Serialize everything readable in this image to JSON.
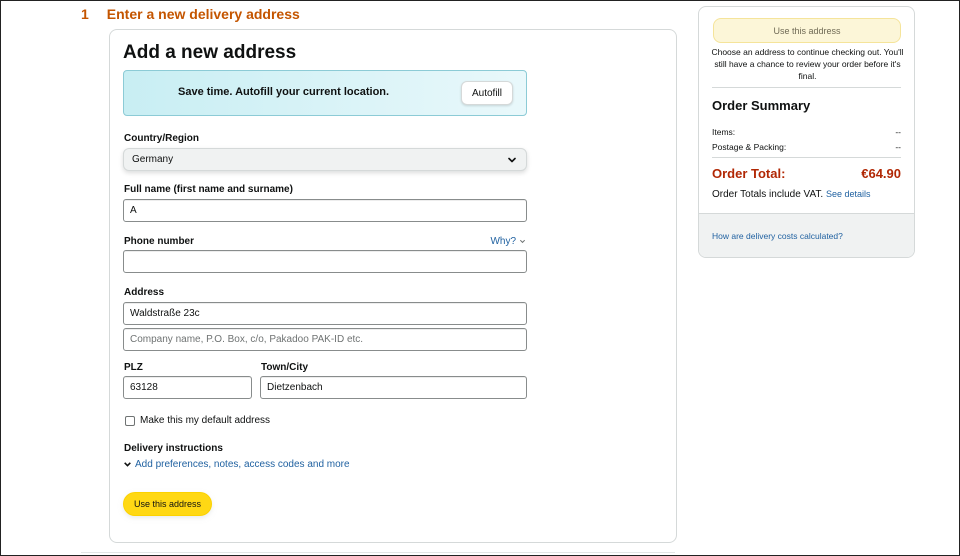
{
  "step": {
    "number": "1",
    "title": "Enter a new delivery address"
  },
  "form": {
    "title": "Add a new address",
    "autofill": {
      "text": "Save time. Autofill your current location.",
      "button": "Autofill"
    },
    "country": {
      "label": "Country/Region",
      "value": "Germany"
    },
    "full_name": {
      "label": "Full name (first name and surname)",
      "value": "A"
    },
    "phone": {
      "label": "Phone number",
      "value": "",
      "why_link": "Why?"
    },
    "address": {
      "label": "Address",
      "line1_value": "Waldstraße 23c",
      "line2_placeholder": "Company name, P.O. Box, c/o, Pakadoo PAK-ID etc."
    },
    "plz": {
      "label": "PLZ",
      "value": "63128"
    },
    "city": {
      "label": "Town/City",
      "value": "Dietzenbach"
    },
    "default_checkbox": {
      "label": "Make this my default address",
      "checked": false
    },
    "delivery_instructions": {
      "title": "Delivery instructions",
      "link": "Add preferences, notes, access codes and more"
    },
    "submit_button": "Use this address"
  },
  "summary": {
    "use_button": "Use this address",
    "note": "Choose an address to continue checking out. You'll still have a chance to review your order before it's final.",
    "title": "Order Summary",
    "items_label": "Items:",
    "items_value": "--",
    "postage_label": "Postage & Packing:",
    "postage_value": "--",
    "total_label": "Order Total:",
    "total_value": "€64.90",
    "vat_text": "Order Totals include VAT.",
    "vat_link": "See details",
    "delivery_cost_link": "How are delivery costs calculated?"
  },
  "colors": {
    "accent_orange": "#c45500",
    "link_blue": "#2162a1",
    "button_yellow": "#ffd814",
    "total_red": "#b12704"
  }
}
